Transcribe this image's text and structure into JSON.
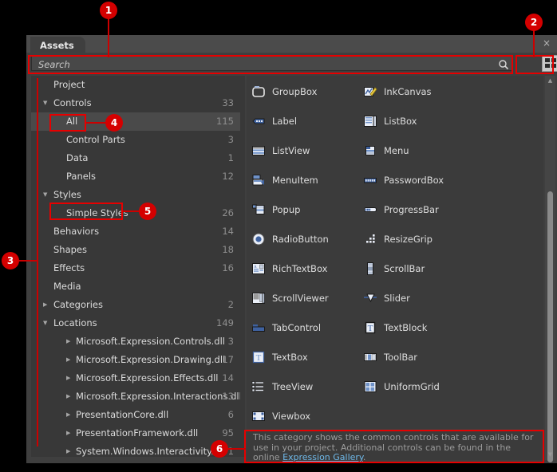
{
  "window": {
    "tab_label": "Assets",
    "close_label": "×"
  },
  "search": {
    "placeholder": "Search",
    "value": "",
    "icon": "search-icon"
  },
  "view_modes": [
    {
      "name": "grid-view-button",
      "icon": "grid-icon",
      "selected": true
    },
    {
      "name": "list-view-button",
      "icon": "list-icon",
      "selected": false
    }
  ],
  "tree": {
    "items": [
      {
        "label": "Project",
        "count": "",
        "level": 0,
        "arrow": "",
        "selected": false
      },
      {
        "label": "Controls",
        "count": "33",
        "level": 0,
        "arrow": "▼",
        "selected": false
      },
      {
        "label": "All",
        "count": "115",
        "level": 1,
        "arrow": "",
        "selected": true
      },
      {
        "label": "Control Parts",
        "count": "3",
        "level": 1,
        "arrow": "",
        "selected": false
      },
      {
        "label": "Data",
        "count": "1",
        "level": 1,
        "arrow": "",
        "selected": false
      },
      {
        "label": "Panels",
        "count": "12",
        "level": 1,
        "arrow": "",
        "selected": false
      },
      {
        "label": "Styles",
        "count": "",
        "level": 0,
        "arrow": "▼",
        "selected": false
      },
      {
        "label": "Simple Styles",
        "count": "26",
        "level": 1,
        "arrow": "",
        "selected": false
      },
      {
        "label": "Behaviors",
        "count": "14",
        "level": 0,
        "arrow": "",
        "selected": false
      },
      {
        "label": "Shapes",
        "count": "18",
        "level": 0,
        "arrow": "",
        "selected": false
      },
      {
        "label": "Effects",
        "count": "16",
        "level": 0,
        "arrow": "",
        "selected": false
      },
      {
        "label": "Media",
        "count": "",
        "level": 0,
        "arrow": "",
        "selected": false
      },
      {
        "label": "Categories",
        "count": "2",
        "level": 0,
        "arrow": "▶",
        "selected": false
      },
      {
        "label": "Locations",
        "count": "149",
        "level": 0,
        "arrow": "▼",
        "selected": false
      },
      {
        "label": "Microsoft.Expression.Controls.dll",
        "count": "3",
        "level": 2,
        "arrow": "▶",
        "selected": false
      },
      {
        "label": "Microsoft.Expression.Drawing.dll",
        "count": "17",
        "level": 2,
        "arrow": "▶",
        "selected": false
      },
      {
        "label": "Microsoft.Expression.Effects.dll",
        "count": "14",
        "level": 2,
        "arrow": "▶",
        "selected": false
      },
      {
        "label": "Microsoft.Expression.Interactions.dll",
        "count": "13",
        "level": 2,
        "arrow": "▶",
        "selected": false
      },
      {
        "label": "PresentationCore.dll",
        "count": "6",
        "level": 2,
        "arrow": "▶",
        "selected": false
      },
      {
        "label": "PresentationFramework.dll",
        "count": "95",
        "level": 2,
        "arrow": "▶",
        "selected": false
      },
      {
        "label": "System.Windows.Interactivity.dll",
        "count": "1",
        "level": 2,
        "arrow": "▶",
        "selected": false
      }
    ]
  },
  "assets": {
    "items": [
      {
        "label": "GroupBox",
        "icon": "groupbox-icon"
      },
      {
        "label": "InkCanvas",
        "icon": "inkcanvas-icon"
      },
      {
        "label": "Label",
        "icon": "label-icon"
      },
      {
        "label": "ListBox",
        "icon": "listbox-icon"
      },
      {
        "label": "ListView",
        "icon": "listview-icon"
      },
      {
        "label": "Menu",
        "icon": "menu-icon"
      },
      {
        "label": "MenuItem",
        "icon": "menuitem-icon"
      },
      {
        "label": "PasswordBox",
        "icon": "passwordbox-icon"
      },
      {
        "label": "Popup",
        "icon": "popup-icon"
      },
      {
        "label": "ProgressBar",
        "icon": "progressbar-icon"
      },
      {
        "label": "RadioButton",
        "icon": "radiobutton-icon"
      },
      {
        "label": "ResizeGrip",
        "icon": "resizegrip-icon"
      },
      {
        "label": "RichTextBox",
        "icon": "richtextbox-icon"
      },
      {
        "label": "ScrollBar",
        "icon": "scrollbar-icon"
      },
      {
        "label": "ScrollViewer",
        "icon": "scrollviewer-icon"
      },
      {
        "label": "Slider",
        "icon": "slider-icon"
      },
      {
        "label": "TabControl",
        "icon": "tabcontrol-icon"
      },
      {
        "label": "TextBlock",
        "icon": "textblock-icon"
      },
      {
        "label": "TextBox",
        "icon": "textbox-icon"
      },
      {
        "label": "ToolBar",
        "icon": "toolbar-icon"
      },
      {
        "label": "TreeView",
        "icon": "treeview-icon"
      },
      {
        "label": "UniformGrid",
        "icon": "uniformgrid-icon"
      },
      {
        "label": "Viewbox",
        "icon": "viewbox-icon"
      }
    ]
  },
  "description": {
    "text_before": "This category shows the common controls that are available for use in your project. Additional controls can be found in the online ",
    "link_text": "Expression Gallery",
    "text_after": "."
  },
  "scrollbar": {
    "up_glyph": "▲",
    "down_glyph": "▼"
  },
  "annotations": {
    "badges": [
      {
        "number": "1"
      },
      {
        "number": "2"
      },
      {
        "number": "3"
      },
      {
        "number": "4"
      },
      {
        "number": "5"
      },
      {
        "number": "6"
      }
    ]
  },
  "colors": {
    "accent_red": "#d40000",
    "panel_bg": "#3f3f3f",
    "tab_bg": "#4b4b4b",
    "text": "#dcdcdc",
    "muted_text": "#8f8f8f",
    "link": "#6fb8e8"
  }
}
